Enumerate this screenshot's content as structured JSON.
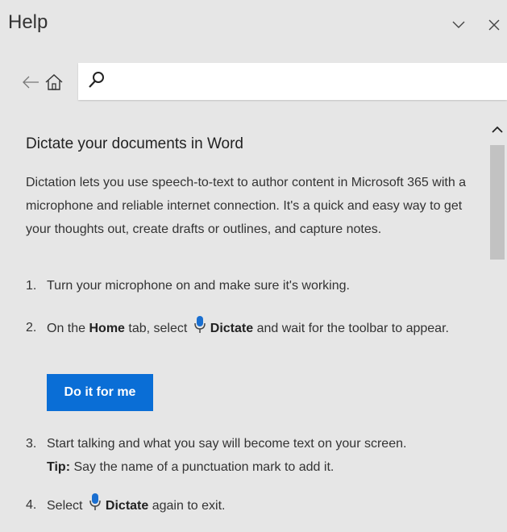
{
  "pane": {
    "title": "Help",
    "collapse_icon": "chevron-down-icon",
    "close_icon": "close-icon"
  },
  "nav": {
    "back_icon": "arrow-left-icon",
    "home_icon": "home-icon",
    "search_icon": "search-icon",
    "search_value": ""
  },
  "article": {
    "title": "Dictate your documents in Word",
    "intro": "Dictation lets you use speech-to-text to author content in Microsoft 365 with a microphone and reliable internet connection. It's a quick and easy way to get your thoughts out, create drafts or outlines, and capture notes.",
    "steps": [
      {
        "num": "1.",
        "text": "Turn your microphone on and make sure it's working."
      },
      {
        "num": "2.",
        "pre": "On the ",
        "home": "Home",
        "mid": " tab, select ",
        "dictate": "Dictate",
        "post": " and wait for the toolbar to appear."
      },
      {
        "num": "3.",
        "text": "Start talking and what you say will become text on your screen.",
        "tip_label": "Tip:",
        "tip_text": " Say the name of a punctuation mark to add it."
      },
      {
        "num": "4.",
        "pre": "Select ",
        "dictate": "Dictate",
        "post": " again to exit."
      }
    ],
    "do_it_button": "Do it for me"
  },
  "colors": {
    "accent": "#0a6ed6",
    "mic": "#1a6fd0",
    "background": "#e6e6e6"
  }
}
